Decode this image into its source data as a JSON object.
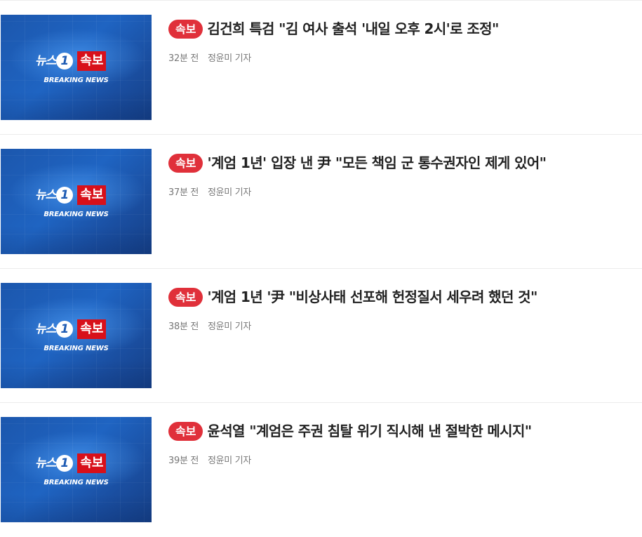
{
  "thumbnail": {
    "news_text": "뉴스",
    "one_text": "1",
    "flash_text": "속보",
    "breaking_text": "BREAKING NEWS"
  },
  "articles": [
    {
      "badge": "속보",
      "title": "김건희 특검 \"김 여사 출석 '내일 오후 2시'로 조정\"",
      "time": "32분 전",
      "author": "정윤미 기자"
    },
    {
      "badge": "속보",
      "title": "'계엄 1년' 입장 낸 尹 \"모든 책임 군 통수권자인 제게 있어\"",
      "time": "37분 전",
      "author": "정윤미 기자"
    },
    {
      "badge": "속보",
      "title": "'계엄 1년 '尹 \"비상사태 선포해 헌정질서 세우려 했던 것\"",
      "time": "38분 전",
      "author": "정윤미 기자"
    },
    {
      "badge": "속보",
      "title": " 윤석열 \"계엄은 주권 침탈 위기 직시해 낸 절박한 메시지\"",
      "time": "39분 전",
      "author": "정윤미 기자"
    }
  ],
  "colors": {
    "badge_red": "#e0303a",
    "logo_flash_red": "#d8101a",
    "thumbnail_blue": "#1f64c2",
    "title_text": "#222222",
    "meta_text": "#777777"
  },
  "icons": {
    "logo": "news1-breaking-news-logo"
  }
}
